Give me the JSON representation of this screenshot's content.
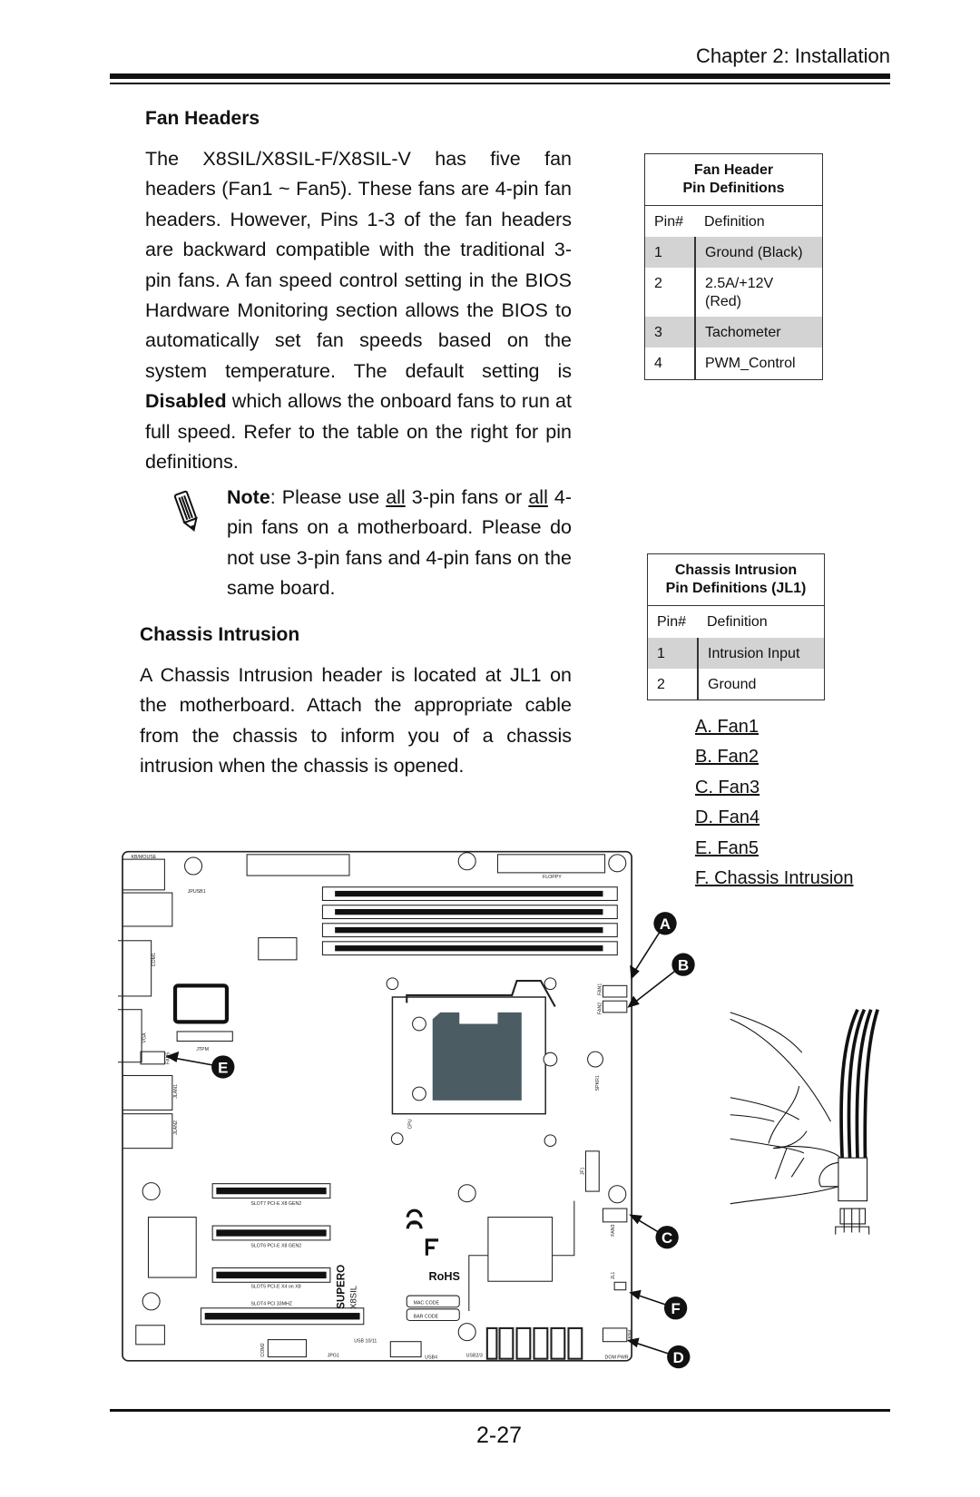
{
  "header": {
    "chapter": "Chapter 2: Installation"
  },
  "fan_section": {
    "title": "Fan Headers",
    "para_before": "The X8SIL/X8SIL-F/X8SIL-V has five fan headers (Fan1 ~ Fan5). These fans are 4-pin fan headers. However, Pins 1-3 of the fan headers are backward compatible with the traditional 3-pin fans. A fan speed control setting in the BIOS Hardware Monitoring section allows the BIOS to automatically set fan speeds based on the system temperature.  The default setting is ",
    "para_bold": "Disabled",
    "para_after": " which allows the onboard fans to run at full speed. Refer to the table on the right for pin definitions.",
    "note": {
      "icon": "pencil-icon",
      "label": "Note",
      "t1": ": Please use ",
      "u1": "all",
      "t2": " 3-pin fans or ",
      "u2": "all",
      "t3": " 4-pin fans on a motherboard. Please do not use 3-pin fans and 4-pin fans on the same board."
    }
  },
  "fan_table": {
    "title_line1": "Fan Header",
    "title_line2": "Pin Definitions",
    "col_pin": "Pin#",
    "col_def": "Definition",
    "rows": [
      {
        "pin": "1",
        "def": "Ground (Black)"
      },
      {
        "pin": "2",
        "def": "2.5A/+12V (Red)"
      },
      {
        "pin": "3",
        "def": "Tachometer"
      },
      {
        "pin": "4",
        "def": "PWM_Control"
      }
    ]
  },
  "chassis_section": {
    "title": "Chassis Intrusion",
    "para": "A Chassis Intrusion header is located at JL1 on the motherboard. Attach the appropriate cable from the chassis to inform you of a chassis intrusion when the chassis is opened."
  },
  "chassis_table": {
    "title_line1": "Chassis Intrusion",
    "title_line2": "Pin Definitions (JL1)",
    "col_pin": "Pin#",
    "col_def": "Definition",
    "rows": [
      {
        "pin": "1",
        "def": "Intrusion Input"
      },
      {
        "pin": "2",
        "def": "Ground"
      }
    ]
  },
  "legend_links": [
    "A. Fan1",
    "B. Fan2",
    "C. Fan3",
    "D. Fan4",
    "E. Fan5",
    "F. Chassis Intrusion"
  ],
  "callouts": [
    "A",
    "B",
    "C",
    "D",
    "E",
    "F"
  ],
  "board_labels": {
    "kbmouse": "KB/MOUSE",
    "jpusb1": "JPUSB1",
    "floppy": "FLOPPY",
    "com1": "COM1",
    "vga": "VGA",
    "fan5": "FAN5",
    "jtpm": "JTPM",
    "jlan1": "JLAN1",
    "jlan2": "JLAN2",
    "cpu": "CPU",
    "fan1": "FAN1",
    "fan2": "FAN2",
    "fan3": "FAN3",
    "fan4": "FAN4",
    "jl1": "JL1",
    "slot7": "SLOT7 PCI-E X8 GEN2",
    "slot6": "SLOT6 PCI-E X8 GEN2",
    "slot5": "SLOT5 PCI-E X4 on X8",
    "slot4": "SLOT4 PCI 33MHZ",
    "mac": "MAC CODE",
    "bar": "BAR CODE",
    "rohs": "RoHS",
    "brand": "SUPERO",
    "model": "X8SIL",
    "com2": "COM2",
    "usb4": "USB4",
    "usb23": "USB2/3",
    "usb1011": "USB 10/11",
    "dompwr": "DOM PWR",
    "jf1": "JF1",
    "jpg1": "JPG1",
    "spkr1": "SPKR1"
  },
  "footer": {
    "page_number": "2-27"
  }
}
